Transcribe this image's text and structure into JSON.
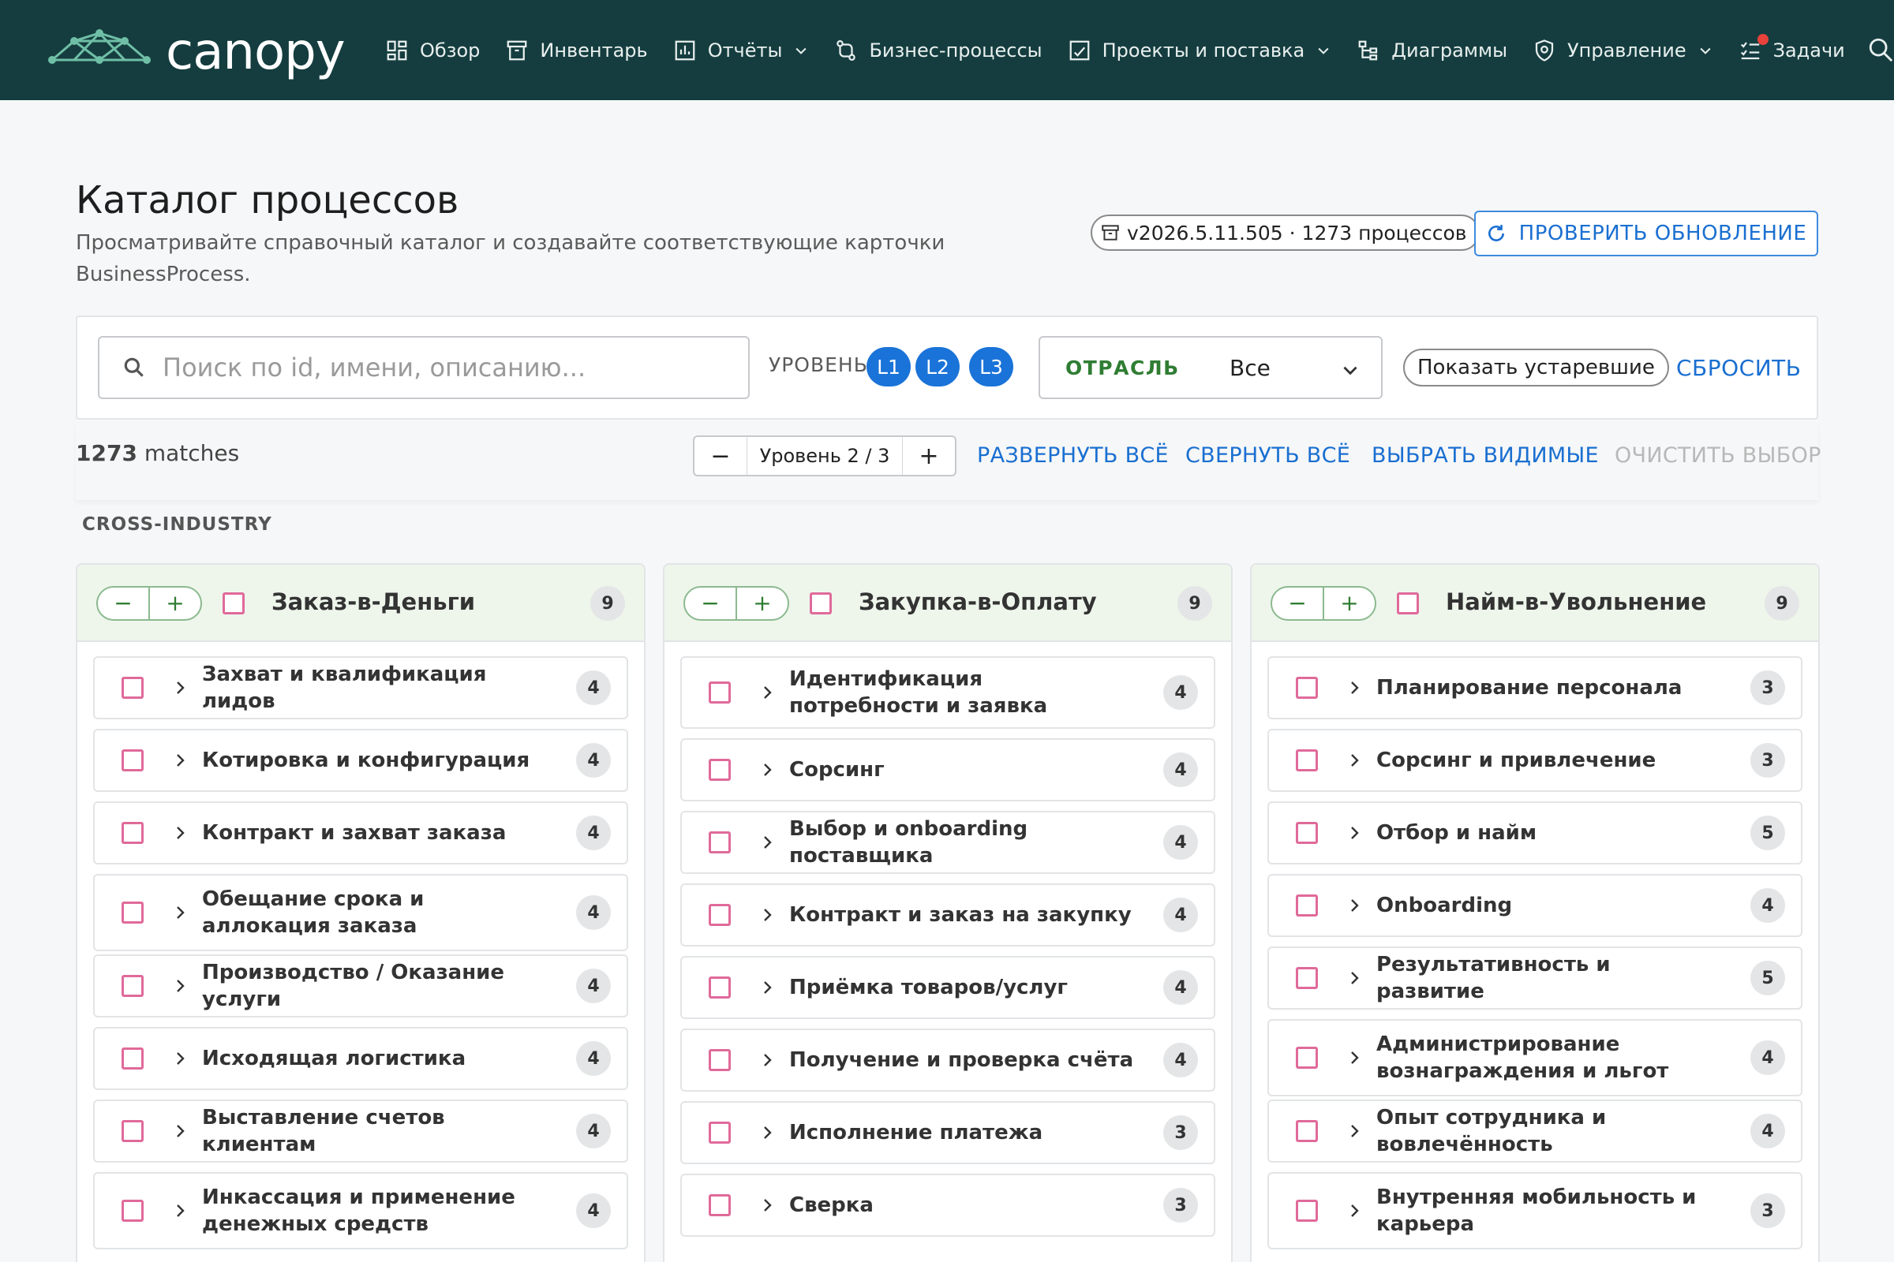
{
  "nav": {
    "logo_text": "canopy",
    "items": [
      {
        "label": "Обзор",
        "icon": "dashboard-icon",
        "has_dropdown": false
      },
      {
        "label": "Инвентарь",
        "icon": "archive-icon",
        "has_dropdown": false
      },
      {
        "label": "Отчёты",
        "icon": "report-icon",
        "has_dropdown": true
      },
      {
        "label": "Бизнес-процессы",
        "icon": "flow-icon",
        "has_dropdown": false
      },
      {
        "label": "Проекты и поставка",
        "icon": "project-icon",
        "has_dropdown": true
      },
      {
        "label": "Диаграммы",
        "icon": "diagram-icon",
        "has_dropdown": false
      },
      {
        "label": "Управление",
        "icon": "shield-icon",
        "has_dropdown": true
      },
      {
        "label": "Задачи",
        "icon": "tasks-icon",
        "has_dropdown": false,
        "notification": true
      }
    ]
  },
  "header": {
    "title": "Каталог процессов",
    "description": "Просматривайте справочный каталог и создавайте соответствующие карточки BusinessProcess.",
    "version": "v2026.5.11.505 · 1273 процессов",
    "check_update": "ПРОВЕРИТЬ ОБНОВЛЕНИЕ"
  },
  "filters": {
    "search_placeholder": "Поиск по id, имени, описанию...",
    "level_label": "УРОВЕНЬ",
    "levels": [
      "L1",
      "L2",
      "L3"
    ],
    "industry_label": "ОТРАСЛЬ",
    "industry_value": "Все",
    "show_obsolete": "Показать устаревшие",
    "reset": "СБРОСИТЬ"
  },
  "toolbar": {
    "match_count": "1273",
    "match_suffix": "matches",
    "level_stepper": "Уровень 2 / 3",
    "minus": "−",
    "plus": "+",
    "expand_all": "РАЗВЕРНУТЬ ВСЁ",
    "collapse_all": "СВЕРНУТЬ ВСЁ",
    "select_visible": "ВЫБРАТЬ ВИДИМЫЕ",
    "clear_selection": "ОЧИСТИТЬ ВЫБОР"
  },
  "group": {
    "label": "CROSS-INDUSTRY"
  },
  "columns": [
    {
      "title": "Заказ-в-Деньги",
      "count": "9",
      "items": [
        {
          "label": "Захват и квалификация лидов",
          "count": "4"
        },
        {
          "label": "Котировка и конфигурация",
          "count": "4"
        },
        {
          "label": "Контракт и захват заказа",
          "count": "4"
        },
        {
          "label": "Обещание срока и аллокация заказа",
          "count": "4"
        },
        {
          "label": "Производство / Оказание услуги",
          "count": "4"
        },
        {
          "label": "Исходящая логистика",
          "count": "4"
        },
        {
          "label": "Выставление счетов клиентам",
          "count": "4"
        },
        {
          "label": "Инкассация и применение денежных средств",
          "count": "4"
        }
      ]
    },
    {
      "title": "Закупка-в-Оплату",
      "count": "9",
      "items": [
        {
          "label": "Идентификация потребности и заявка",
          "count": "4"
        },
        {
          "label": "Сорсинг",
          "count": "4"
        },
        {
          "label": "Выбор и onboarding поставщика",
          "count": "4"
        },
        {
          "label": "Контракт и заказ на закупку",
          "count": "4"
        },
        {
          "label": "Приёмка товаров/услуг",
          "count": "4"
        },
        {
          "label": "Получение и проверка счёта",
          "count": "4"
        },
        {
          "label": "Исполнение платежа",
          "count": "3"
        },
        {
          "label": "Сверка",
          "count": "3"
        }
      ]
    },
    {
      "title": "Найм-в-Увольнение",
      "count": "9",
      "items": [
        {
          "label": "Планирование персонала",
          "count": "3"
        },
        {
          "label": "Сорсинг и привлечение",
          "count": "3"
        },
        {
          "label": "Отбор и найм",
          "count": "5"
        },
        {
          "label": "Onboarding",
          "count": "4"
        },
        {
          "label": "Результативность и развитие",
          "count": "5"
        },
        {
          "label": "Администрирование вознаграждения и льгот",
          "count": "4"
        },
        {
          "label": "Опыт сотрудника и вовлечённость",
          "count": "4"
        },
        {
          "label": "Внутренняя мобильность и карьера",
          "count": "3"
        }
      ]
    }
  ],
  "colors": {
    "nav_bg": "#153d3f",
    "accent": "#1a73d8",
    "green": "#2f7d33",
    "checkbox": "#e06a9a"
  }
}
